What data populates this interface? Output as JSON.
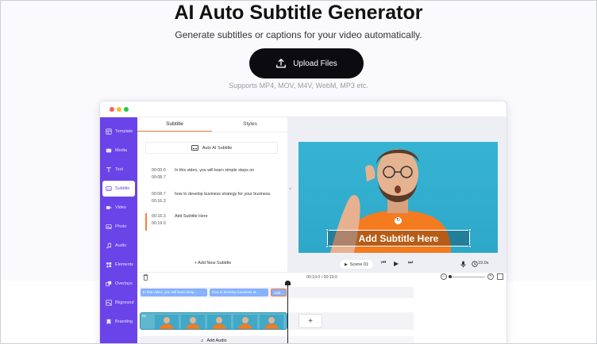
{
  "hero": {
    "title": "AI Auto Subtitle Generator",
    "subtitle": "Generate subtitles or captions for your video automatically.",
    "upload_label": "Upload Files",
    "supports": "Supports MP4, MOV, M4V, WebM, MP3 etc."
  },
  "sidebar": {
    "items": [
      {
        "label": "Template",
        "icon": "template-icon"
      },
      {
        "label": "Media",
        "icon": "media-icon"
      },
      {
        "label": "Text",
        "icon": "text-icon"
      },
      {
        "label": "Subtitle",
        "icon": "subtitle-icon"
      },
      {
        "label": "Video",
        "icon": "video-icon"
      },
      {
        "label": "Photo",
        "icon": "photo-icon"
      },
      {
        "label": "Audio",
        "icon": "audio-icon"
      },
      {
        "label": "Elements",
        "icon": "elements-icon"
      },
      {
        "label": "Overlays",
        "icon": "overlays-icon"
      },
      {
        "label": "Bkground",
        "icon": "background-icon"
      },
      {
        "label": "Branding",
        "icon": "branding-icon"
      }
    ],
    "active": "Subtitle"
  },
  "panel": {
    "tabs": [
      "Subtitle",
      "Styles"
    ],
    "auto_button": "Auto AI Subtitle",
    "cues": [
      {
        "start": "00:00.0",
        "end": "00:08.7",
        "text": "In this video, you will learn simple steps on"
      },
      {
        "start": "00:08.7",
        "end": "00:16.3",
        "text": "how to develop business strategy for your business."
      },
      {
        "start": "00:16.3",
        "end": "00:19.0",
        "text": "Add Subtitle Here"
      }
    ],
    "add_new": "Add New Subtitle"
  },
  "preview": {
    "subtitle_overlay": "Add Subtitle Here",
    "scene_label": "Scene 01",
    "duration": "19.0s"
  },
  "timeline": {
    "timecode": "00:19.0 / 00:19.0",
    "subtitle_clips": [
      "In this video, you will learn simp...",
      "how to develop business st...",
      "Add..."
    ],
    "track_number": "01",
    "add_audio": "Add Audio"
  },
  "colors": {
    "sidebar": "#6a44e8",
    "accent": "#ff7a3d",
    "upload_button": "#0b0b10",
    "subtitle_clip": "#86b2ff"
  }
}
